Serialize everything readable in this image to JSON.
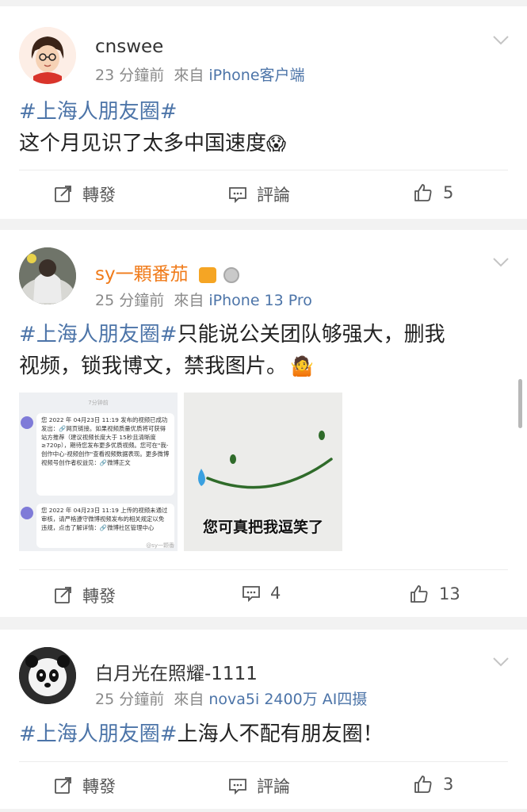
{
  "posts": [
    {
      "username": "cnswee",
      "time": "23 分鐘前",
      "from_label": "來自",
      "source": "iPhone客户端",
      "hashtag": "#上海人朋友圈#",
      "text": "这个月见识了太多中国速度",
      "emoji": "😱",
      "repost_label": "轉發",
      "comment_label": "評論",
      "like_count": "5"
    },
    {
      "username": "sy一顆番茄",
      "time": "25 分鐘前",
      "from_label": "來自",
      "source": "iPhone 13 Pro",
      "hashtag": "#上海人朋友圈#",
      "text_line1": "只能说公关团队够强大，删我",
      "text_line2": "视频，锁我博文，禁我图片。",
      "emoji": "🤷",
      "image1": {
        "time": "7分钟前",
        "msg1": "您 2022 年 04月23日 11:19 发布的视频已成功发出：🔗网页链接。如果视频质量优质将可获得站方推荐（建议视频长度大于 15秒且清晰度≥720p），期待您发布更多优质视频。您可在\"我-创作中心-视频创作\"查看视频数据表现。更多微博视频号创作者权益见：🔗微博正文",
        "msg2": "您 2022 年 04月23日 11:19 上传的视频未通过审核，请严格遵守微博视频发布的相关规定以免违规，点击了解详情：🔗微博社区管理中心",
        "watermark": "@sy一颗番"
      },
      "image2": {
        "caption": "您可真把我逗笑了"
      },
      "repost_label": "轉發",
      "comment_count": "4",
      "like_count": "13"
    },
    {
      "username": "白月光在照耀-1111",
      "time": "25 分鐘前",
      "from_label": "來自",
      "source": "nova5i 2400万 AI四摄",
      "hashtag": "#上海人朋友圈#",
      "text": "上海人不配有朋友圈！",
      "repost_label": "轉發",
      "comment_label": "評論",
      "like_count": "3"
    }
  ],
  "colors": {
    "link": "#4c74a8",
    "vip_name": "#f07b1a",
    "meta": "#8a8a8a"
  }
}
